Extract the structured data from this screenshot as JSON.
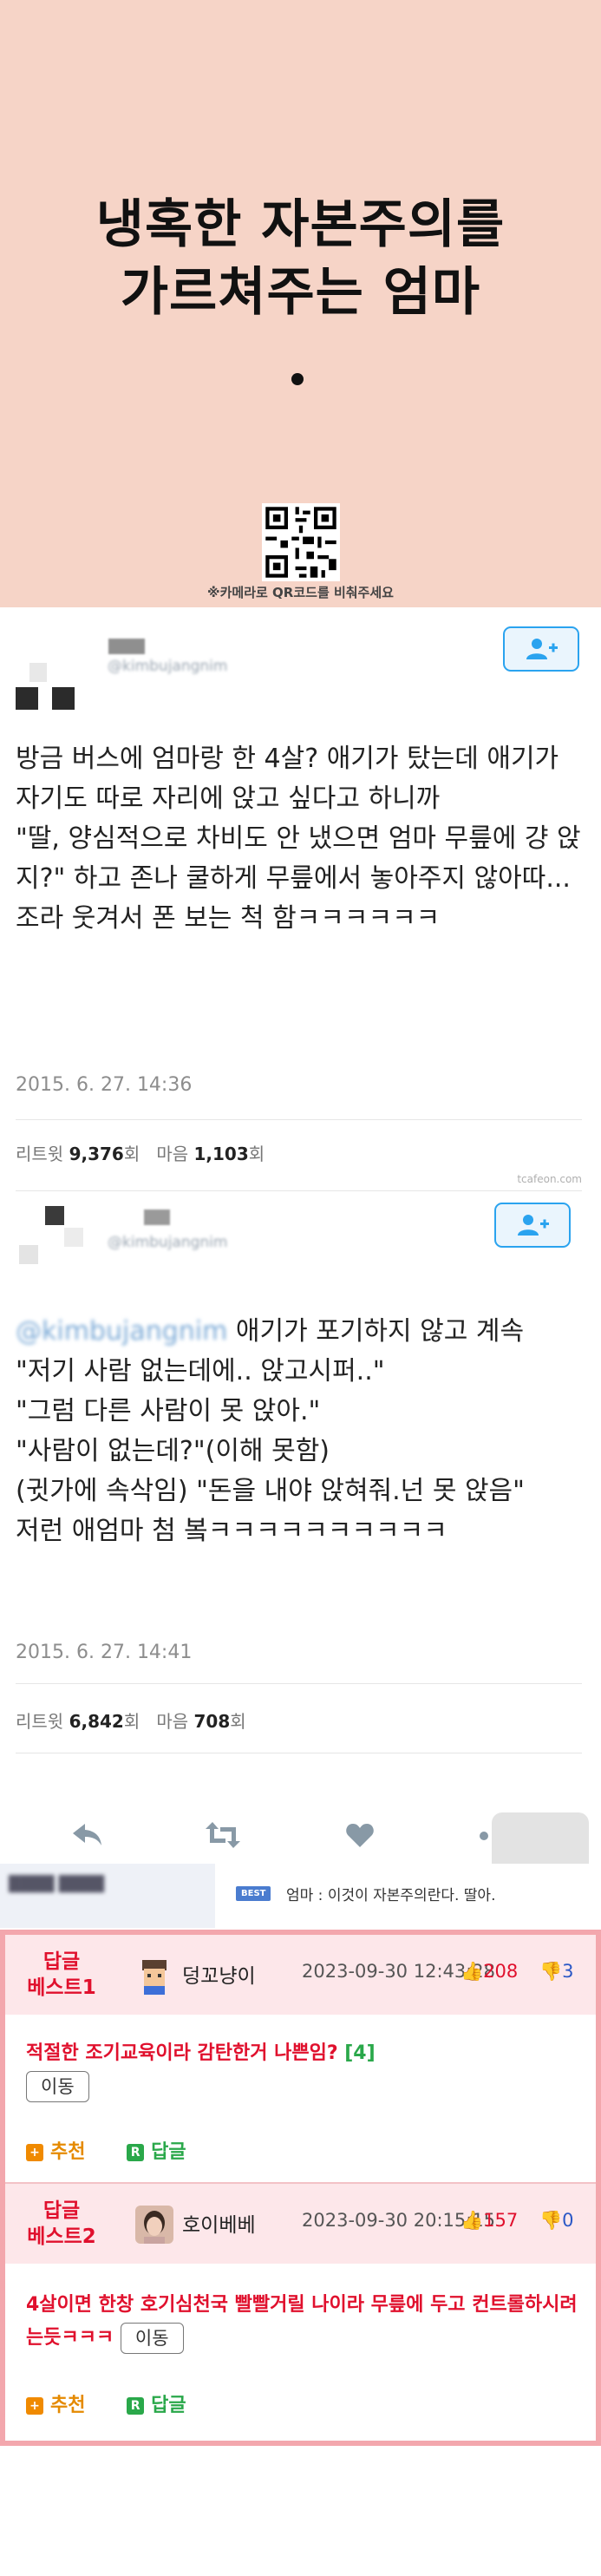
{
  "title_panel": {
    "title_line1": "냉혹한 자본주의를",
    "title_line2": "가르쳐주는 엄마",
    "qr_hint": "※카메라로 QR코드를 비춰주세요",
    "background": "#f6d4c7"
  },
  "tweets": [
    {
      "handle": "@kimbujangnim",
      "text": "방금 버스에 엄마랑 한 4살? 애기가 탔는데 애기가 자기도 따로 자리에 앉고 싶다고 하니까\n\"딸, 양심적으로 차비도 안 냈으면 엄마 무릎에 걍 앉지?\" 하고 존나 쿨하게 무릎에서 놓아주지 않아따...조라 웃겨서 폰 보는 척 함ㅋㅋㅋㅋㅋㅋ",
      "timestamp": "2015. 6. 27. 14:36",
      "retweet_label": "리트윗",
      "retweet_count": "9,376",
      "retweet_unit": "회",
      "like_label": "마음",
      "like_count": "1,103",
      "like_unit": "회"
    },
    {
      "handle": "@kimbujangnim",
      "mention": "@kimbujangnim",
      "text": " 애기가 포기하지 않고 계속\n\"저기 사람 없는데에.. 앉고시퍼..\"\n\"그럼 다른 사람이 못 앉아.\"\n\"사람이 없는데?\"(이해 못함)\n(귓가에 속삭임) \"돈을 내야 앉혀줘.넌 못 앉음\"\n저런 애엄마 첨 봌ㅋㅋㅋㅋㅋㅋㅋㅋㅋㅋ",
      "timestamp": "2015. 6. 27. 14:41",
      "retweet_label": "리트윗",
      "retweet_count": "6,842",
      "retweet_unit": "회",
      "like_label": "마음",
      "like_count": "708",
      "like_unit": "회"
    }
  ],
  "watermark": "tcafeon.com",
  "actions": {
    "reply_icon": "reply-icon",
    "retweet_icon": "retweet-icon",
    "like_icon": "heart-icon",
    "more_icon": "more-icon"
  },
  "best_bar": {
    "author_blurred": "████ ████",
    "badge": "BEST",
    "text": "엄마 : 이것이 자본주의란다. 딸아."
  },
  "comments": [
    {
      "label_line1": "답글",
      "label_line2": "베스트1",
      "nickname": "덩꼬냥이",
      "date": "2023-09-30 12:43:28",
      "up": "208",
      "down": "3",
      "body": "적절한 조기교육이라 감탄한거 나쁜임? ",
      "reply_count": "[4]",
      "move_label": "이동",
      "recommend_label": "추천",
      "reply_label": "답글"
    },
    {
      "label_line1": "답글",
      "label_line2": "베스트2",
      "nickname": "호이베베",
      "date": "2023-09-30 20:15:15",
      "up": "157",
      "down": "0",
      "body": "4살이면 한창 호기심천국 빨빨거릴 나이라 무릎에 두고 컨트롤하시려는듯ㅋㅋㅋ ",
      "move_label": "이동",
      "recommend_label": "추천",
      "reply_label": "답글"
    }
  ],
  "colors": {
    "accent_red": "#e0102d",
    "twitter_blue": "#2aa3ef",
    "comment_border": "#f3a7ad"
  }
}
